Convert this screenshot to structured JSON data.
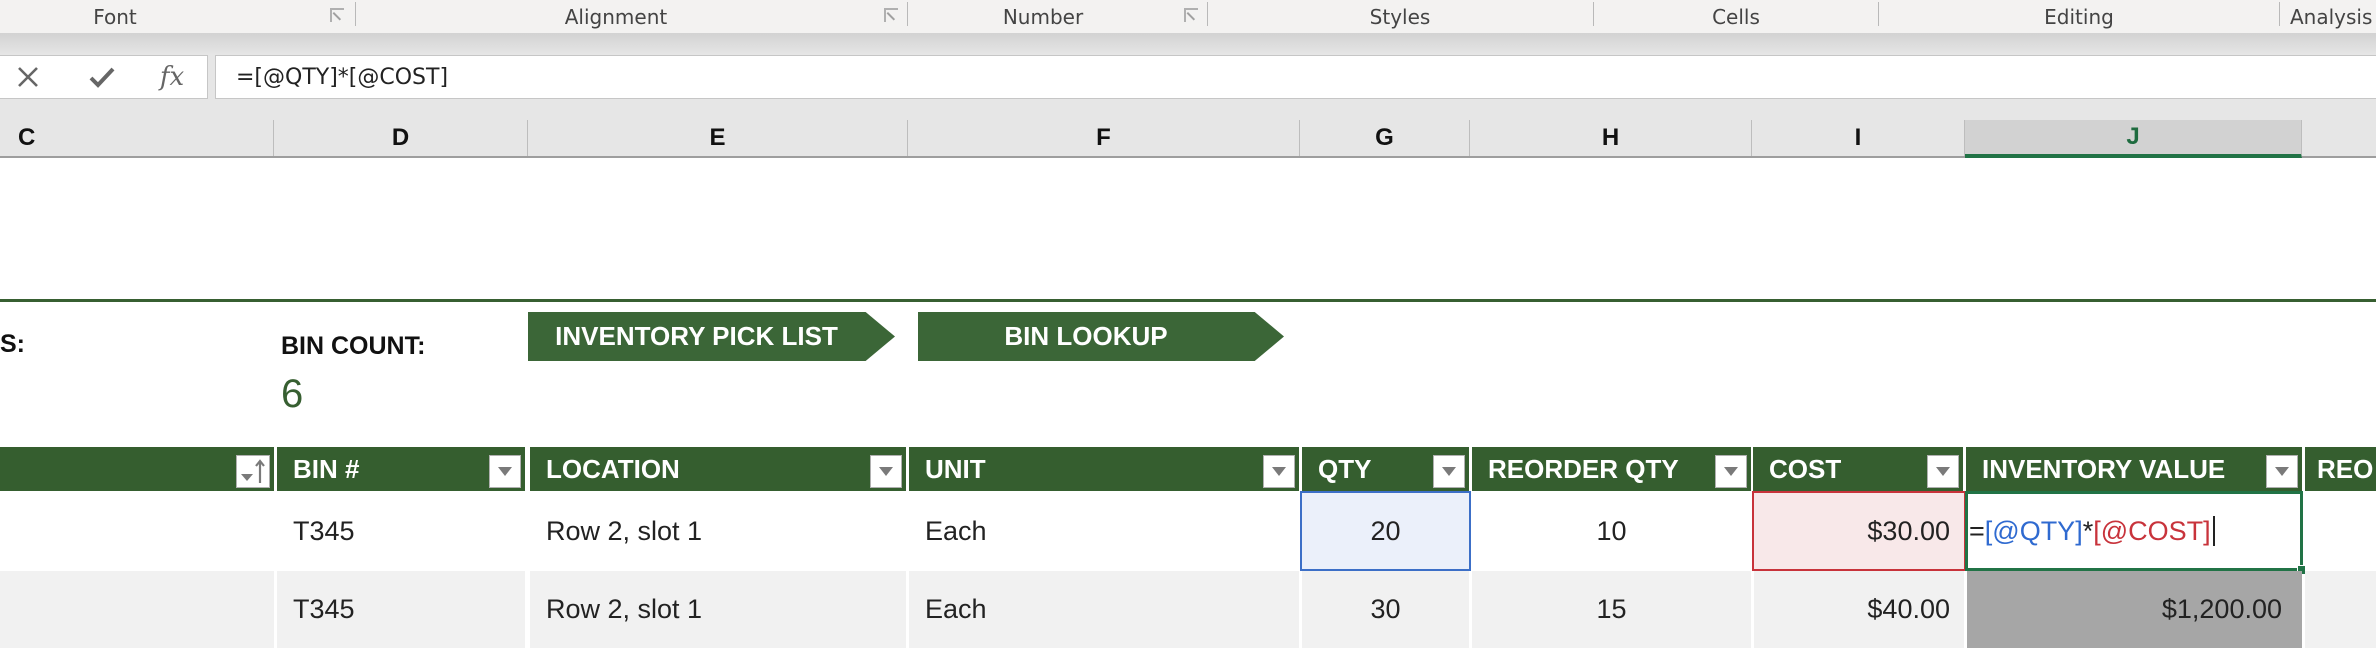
{
  "ribbon": {
    "groups": [
      "Font",
      "Alignment",
      "Number",
      "Styles",
      "Cells",
      "Editing",
      "Analysis"
    ]
  },
  "formula_bar": {
    "cancel_icon": "x-icon",
    "enter_icon": "checkmark-icon",
    "function_icon": "fx-icon",
    "fx_label": "fx",
    "formula": "=[@QTY]*[@COST]"
  },
  "columns": [
    "C",
    "D",
    "E",
    "F",
    "G",
    "H",
    "I",
    "J"
  ],
  "selected_column": "J",
  "summary": {
    "left_label_partial": "S:",
    "bin_count_label": "BIN COUNT:",
    "bin_count_value": "6"
  },
  "nav_buttons": {
    "inventory_pick_list": "INVENTORY PICK LIST",
    "bin_lookup": "BIN LOOKUP"
  },
  "table": {
    "headers": [
      "",
      "BIN #",
      "LOCATION",
      "UNIT",
      "QTY",
      "REORDER QTY",
      "COST",
      "INVENTORY VALUE",
      "REO"
    ],
    "rows": [
      {
        "c": "",
        "bin": "T345",
        "location": "Row 2, slot 1",
        "unit": "Each",
        "qty": "20",
        "reorder_qty": "10",
        "cost": "$30.00",
        "inventory_value": {
          "eq": "=",
          "ref1": "[@QTY]",
          "op": "*",
          "ref2": "[@COST]"
        }
      },
      {
        "c": "",
        "bin": "T345",
        "location": "Row 2, slot 1",
        "unit": "Each",
        "qty": "30",
        "reorder_qty": "15",
        "cost": "$40.00",
        "inventory_value": "$1,200.00"
      }
    ]
  },
  "colors": {
    "accent_green": "#375f31",
    "header_green": "#355e2f",
    "qty_ref_blue": "#2f6ad0",
    "cost_ref_red": "#c8333b",
    "selection_green": "#217346"
  }
}
